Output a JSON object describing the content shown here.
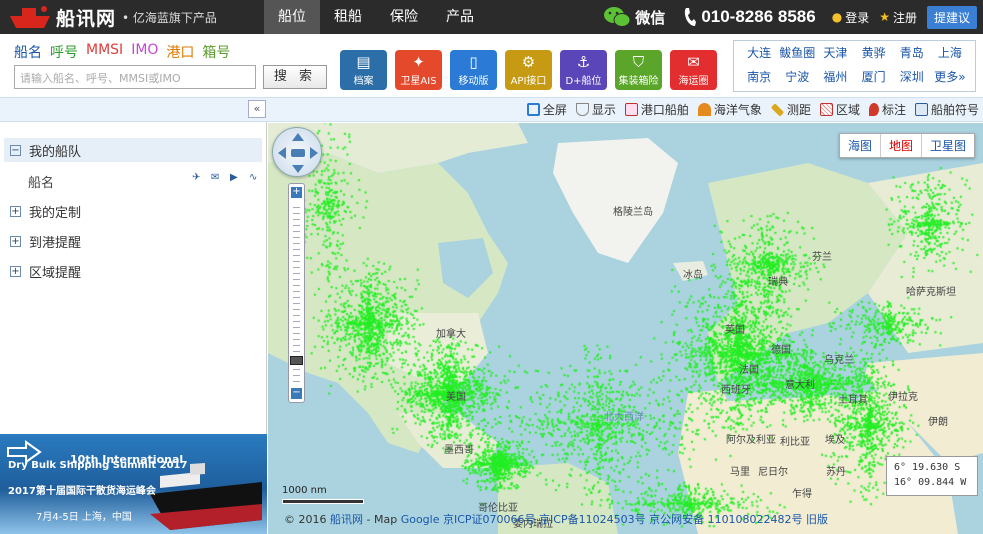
{
  "header": {
    "logo_text": "船讯网",
    "logo_sub": "• 亿海蓝旗下产品",
    "nav": [
      "船位",
      "租船",
      "保险",
      "产品"
    ],
    "active_nav": "船位",
    "wechat": "微信",
    "phone": "010-8286 8586",
    "login": "登录",
    "register": "注册",
    "suggest": "提建议"
  },
  "search": {
    "types": [
      {
        "label": "船名",
        "color": "#1a56a8"
      },
      {
        "label": "呼号",
        "color": "#2c9c2c"
      },
      {
        "label": "MMSI",
        "color": "#e03c3c"
      },
      {
        "label": "IMO",
        "color": "#c04bd0"
      },
      {
        "label": "港口",
        "color": "#e07b00"
      },
      {
        "label": "箱号",
        "color": "#5a9c2a"
      }
    ],
    "placeholder": "请输入船名、呼号、MMSI或IMO",
    "button": "搜 索"
  },
  "features": [
    {
      "label": "档案",
      "color": "#2c6fa8",
      "icon": "doc-icon"
    },
    {
      "label": "卫星AIS",
      "color": "#e4492b",
      "icon": "satellite-icon"
    },
    {
      "label": "移动版",
      "color": "#2b7bd6",
      "icon": "phone-icon"
    },
    {
      "label": "API接口",
      "color": "#c79a13",
      "icon": "gear-icon"
    },
    {
      "label": "D+船位",
      "color": "#5a46b8",
      "icon": "anchor-icon"
    },
    {
      "label": "集装箱险",
      "color": "#5aa52a",
      "icon": "shield-icon"
    },
    {
      "label": "海运圈",
      "color": "#e22e2e",
      "icon": "chat-icon"
    }
  ],
  "ports": [
    "大连",
    "鲅鱼圈",
    "天津",
    "黄骅",
    "青岛",
    "上海",
    "南京",
    "宁波",
    "福州",
    "厦门",
    "深圳",
    "更多»"
  ],
  "toolbar": {
    "collapse": "«",
    "tools": [
      {
        "label": "全屏",
        "color": "#2b7bd6"
      },
      {
        "label": "显示",
        "color": "#888888"
      },
      {
        "label": "港口船舶",
        "color": "#c03030"
      },
      {
        "label": "海洋气象",
        "color": "#e58a1f"
      },
      {
        "label": "测距",
        "color": "#d9a81e"
      },
      {
        "label": "区域",
        "color": "#c03030"
      },
      {
        "label": "标注",
        "color": "#d03a2a"
      },
      {
        "label": "船舶符号",
        "color": "#2b5c99"
      }
    ]
  },
  "sidebar": {
    "fleet": "我的船队",
    "ship_col": "船名",
    "custom": "我的定制",
    "arrive": "到港提醒",
    "area": "区域提醒",
    "banner": {
      "line1": "10th International",
      "line1b": "Dry Bulk Shipping Summit 2017",
      "line2": "2017第十届国际干散货海运峰会",
      "line3": "7月4-5日 上海，中国"
    }
  },
  "map": {
    "types": [
      "海图",
      "地图",
      "卫星图"
    ],
    "active_type": "地图",
    "labels": [
      {
        "text": "格陵兰岛"
      },
      {
        "text": "冰岛"
      },
      {
        "text": "加拿大"
      },
      {
        "text": "美国"
      },
      {
        "text": "墨西哥"
      },
      {
        "text": "北大西洋"
      },
      {
        "text": "芬兰"
      },
      {
        "text": "瑞典"
      },
      {
        "text": "英国"
      },
      {
        "text": "德国"
      },
      {
        "text": "法国"
      },
      {
        "text": "西班牙"
      },
      {
        "text": "意大利"
      },
      {
        "text": "乌克兰"
      },
      {
        "text": "土耳其"
      },
      {
        "text": "阿尔及利亚"
      },
      {
        "text": "利比亚"
      },
      {
        "text": "埃及"
      },
      {
        "text": "马里"
      },
      {
        "text": "尼日尔"
      },
      {
        "text": "乍得"
      },
      {
        "text": "苏丹"
      },
      {
        "text": "伊拉克"
      },
      {
        "text": "伊朗"
      },
      {
        "text": "哈萨克斯坦"
      },
      {
        "text": "委内瑞拉"
      },
      {
        "text": "哥伦比亚"
      }
    ],
    "scale": "1000 nm",
    "copyright_prefix": "© 2016 ",
    "copyright_link": "船讯网",
    "copyright_map": " - Map ",
    "copyright_google": "Google",
    "copyright_icp": " 京ICP证070066号 京ICP备11024503号 京公网安备 110108022482号 旧版",
    "coord_lat": "6° 19.630 S",
    "coord_lon": "16° 09.844 W"
  }
}
